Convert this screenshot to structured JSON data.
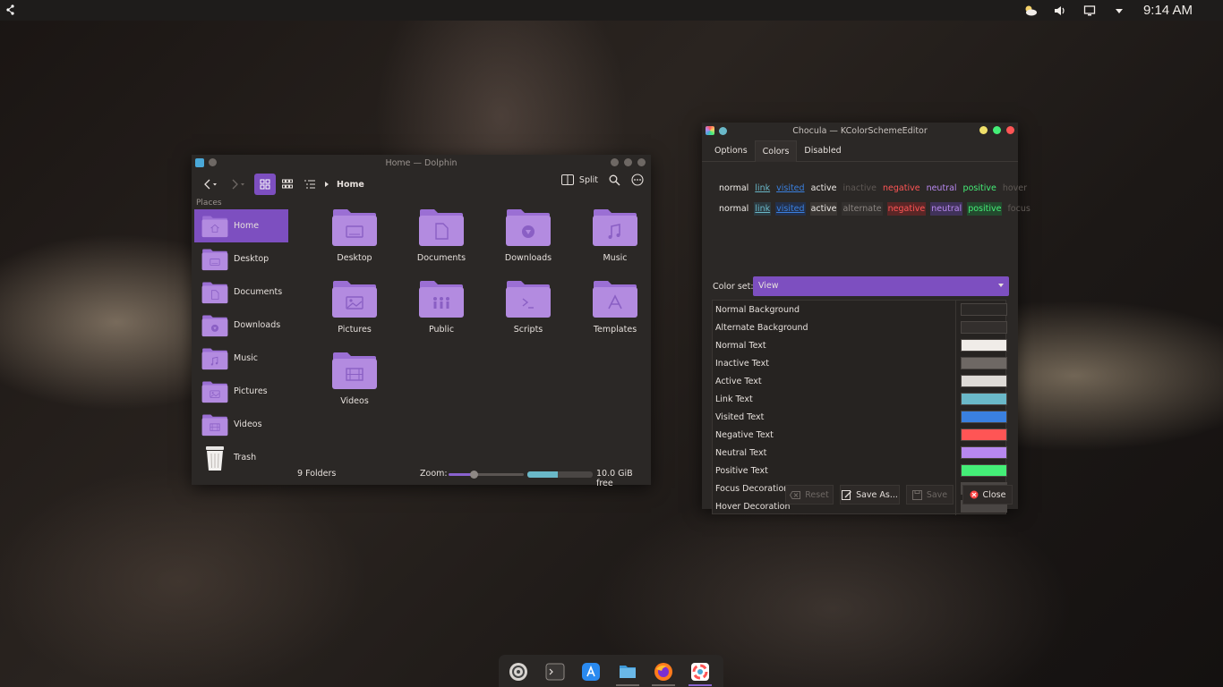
{
  "panel": {
    "clock": "9:14 AM"
  },
  "dolphin": {
    "title": "Home — Dolphin",
    "breadcrumb": "Home",
    "split_label": "Split",
    "places_label": "Places",
    "sidebar": [
      {
        "label": "Home",
        "icon": "home-icon"
      },
      {
        "label": "Desktop",
        "icon": "desktop-folder-icon"
      },
      {
        "label": "Documents",
        "icon": "documents-folder-icon"
      },
      {
        "label": "Downloads",
        "icon": "downloads-folder-icon"
      },
      {
        "label": "Music",
        "icon": "music-folder-icon"
      },
      {
        "label": "Pictures",
        "icon": "pictures-folder-icon"
      },
      {
        "label": "Videos",
        "icon": "videos-folder-icon"
      },
      {
        "label": "Trash",
        "icon": "trash-icon"
      }
    ],
    "folders": [
      {
        "label": "Desktop",
        "icon": "desktop"
      },
      {
        "label": "Documents",
        "icon": "documents"
      },
      {
        "label": "Downloads",
        "icon": "downloads"
      },
      {
        "label": "Music",
        "icon": "music"
      },
      {
        "label": "Pictures",
        "icon": "pictures"
      },
      {
        "label": "Public",
        "icon": "public"
      },
      {
        "label": "Scripts",
        "icon": "scripts"
      },
      {
        "label": "Templates",
        "icon": "templates"
      },
      {
        "label": "Videos",
        "icon": "videos"
      }
    ],
    "status": {
      "count": "9 Folders",
      "zoom_label": "Zoom:",
      "zoom_level": 0.33,
      "disk_used_fraction": 0.47,
      "free": "10.0 GiB free"
    }
  },
  "editor": {
    "title": "Chocula — KColorSchemeEditor",
    "tabs": [
      "Options",
      "Colors",
      "Disabled"
    ],
    "active_tab": "Colors",
    "preview_row1": [
      "normal",
      "link",
      "visited",
      "active",
      "inactive",
      "negative",
      "neutral",
      "positive",
      "hover"
    ],
    "preview_row2": [
      "normal",
      "link",
      "visited",
      "active",
      "alternate",
      "negative",
      "neutral",
      "positive",
      "focus"
    ],
    "color_set_label": "Color set:",
    "color_set_value": "View",
    "colors": [
      {
        "name": "Normal Background",
        "hex": "#2b2826"
      },
      {
        "name": "Alternate Background",
        "hex": "#332f2d"
      },
      {
        "name": "Normal Text",
        "hex": "#f0ece8"
      },
      {
        "name": "Inactive Text",
        "hex": "#6e6864"
      },
      {
        "name": "Active Text",
        "hex": "#dedad6"
      },
      {
        "name": "Link Text",
        "hex": "#6ab8c8"
      },
      {
        "name": "Visited Text",
        "hex": "#3a80e0"
      },
      {
        "name": "Negative Text",
        "hex": "#ff5555"
      },
      {
        "name": "Neutral Text",
        "hex": "#b888f0"
      },
      {
        "name": "Positive Text",
        "hex": "#44ee77"
      },
      {
        "name": "Focus Decoration",
        "hex": "#4a4644"
      },
      {
        "name": "Hover Decoration",
        "hex": "#4a4644"
      }
    ],
    "buttons": {
      "reset": "Reset",
      "save_as": "Save As...",
      "save": "Save",
      "close": "Close"
    }
  },
  "colors": {
    "accent": "#7d4fc0",
    "folder": "#b38be0",
    "folder_dark": "#9b6fd4",
    "link": "#6ab8c8",
    "visited": "#3a80e0",
    "negative": "#ff5555",
    "neutral": "#b888f0",
    "positive": "#44ee77",
    "inactive": "#6e6864"
  },
  "dock": [
    {
      "icon": "settings-icon"
    },
    {
      "icon": "terminal-icon"
    },
    {
      "icon": "app-store-icon"
    },
    {
      "icon": "files-icon"
    },
    {
      "icon": "firefox-icon"
    },
    {
      "icon": "color-scheme-editor-icon"
    }
  ]
}
